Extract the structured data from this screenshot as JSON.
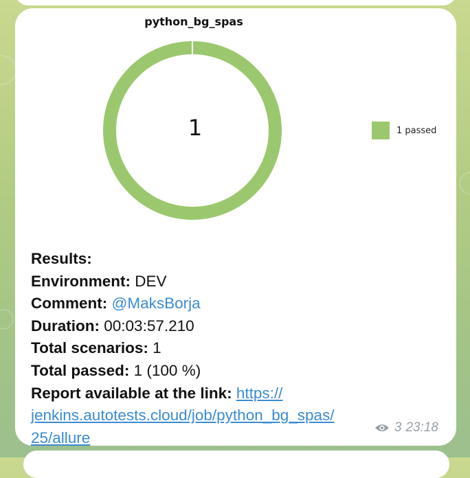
{
  "chart": {
    "title": "python_bg_spas",
    "center_value": "1",
    "legend": [
      {
        "label": "1 passed",
        "color": "#9bc86e"
      }
    ]
  },
  "chart_data": {
    "type": "pie",
    "donut": true,
    "title": "python_bg_spas",
    "categories": [
      "passed"
    ],
    "values": [
      1
    ],
    "colors": [
      "#9bc86e"
    ],
    "legend_position": "right"
  },
  "results": {
    "heading": "Results:",
    "environment_label": "Environment:",
    "environment_value": "DEV",
    "comment_label": "Comment:",
    "comment_value": "@MaksBorja",
    "duration_label": "Duration:",
    "duration_value": "00:03:57.210",
    "scenarios_label": "Total scenarios:",
    "scenarios_value": "1",
    "passed_label": "Total passed:",
    "passed_value": "1 (100 %)",
    "report_label": "Report available at the link:",
    "report_link_line1": "https://",
    "report_link_line2": "jenkins.autotests.cloud/job/python_bg_spas/",
    "report_link_line3": "25/allure"
  },
  "meta": {
    "views": "3",
    "time": "23:18",
    "icon": "eye-icon"
  }
}
